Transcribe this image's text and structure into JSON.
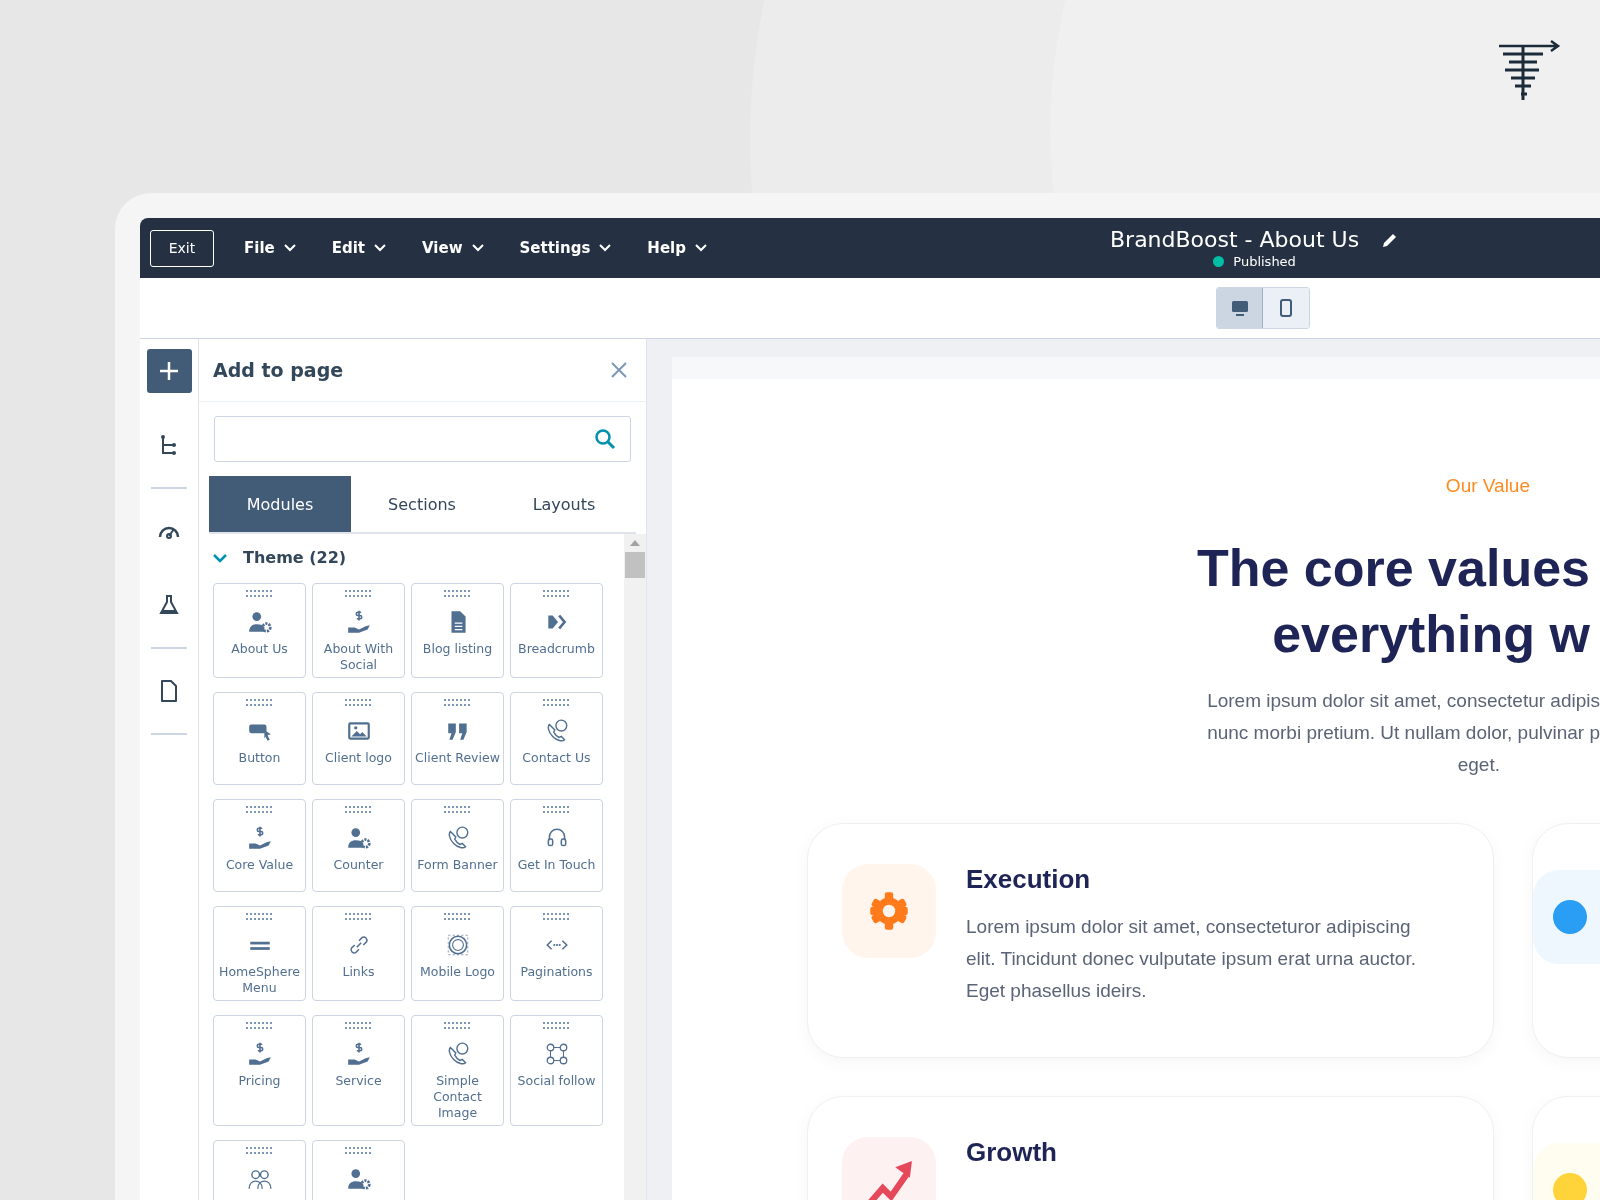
{
  "topbar": {
    "exit": "Exit",
    "menus": [
      {
        "label": "File"
      },
      {
        "label": "Edit"
      },
      {
        "label": "View"
      },
      {
        "label": "Settings"
      },
      {
        "label": "Help"
      }
    ],
    "title": "BrandBoost - About Us",
    "status": {
      "label": "Published",
      "color": "#00bda5"
    }
  },
  "device_toggle": [
    {
      "kind": "desktop",
      "selected": true
    },
    {
      "kind": "mobile",
      "selected": false
    }
  ],
  "rail": [
    {
      "kind": "add",
      "selected": true
    },
    {
      "kind": "tree",
      "selected": false
    },
    {
      "kind": "divider"
    },
    {
      "kind": "gauge",
      "selected": false
    },
    {
      "kind": "flask",
      "selected": false
    },
    {
      "kind": "divider"
    },
    {
      "kind": "page",
      "selected": false
    },
    {
      "kind": "divider"
    }
  ],
  "panel": {
    "title": "Add to page",
    "tabs": [
      {
        "label": "Modules",
        "selected": true
      },
      {
        "label": "Sections",
        "selected": false
      },
      {
        "label": "Layouts",
        "selected": false
      }
    ],
    "group": {
      "label": "Theme (22)",
      "expanded": true
    },
    "modules": [
      {
        "label": "About Us",
        "kind": "person"
      },
      {
        "label": "About With Social",
        "kind": "money"
      },
      {
        "label": "Blog listing",
        "kind": "document"
      },
      {
        "label": "Breadcrumb",
        "kind": "chevrons"
      },
      {
        "label": "Button",
        "kind": "button"
      },
      {
        "label": "Client logo",
        "kind": "image"
      },
      {
        "label": "Client Review",
        "kind": "quote"
      },
      {
        "label": "Contact Us",
        "kind": "phone"
      },
      {
        "label": "Core Value",
        "kind": "money"
      },
      {
        "label": "Counter",
        "kind": "person"
      },
      {
        "label": "Form Banner",
        "kind": "phone"
      },
      {
        "label": "Get In Touch",
        "kind": "headset"
      },
      {
        "label": "HomeSphere Menu",
        "kind": "menu"
      },
      {
        "label": "Links",
        "kind": "link"
      },
      {
        "label": "Mobile Logo",
        "kind": "logo"
      },
      {
        "label": "Paginations",
        "kind": "code"
      },
      {
        "label": "Pricing",
        "kind": "money"
      },
      {
        "label": "Service",
        "kind": "money"
      },
      {
        "label": "Simple Contact Image",
        "kind": "phone"
      },
      {
        "label": "Social follow",
        "kind": "social"
      },
      {
        "kind": "people"
      },
      {
        "kind": "person"
      }
    ]
  },
  "page": {
    "eyebrow": "Our Value",
    "heading": [
      "The core values",
      "everything w"
    ],
    "intro": [
      "Lorem ipsum dolor sit amet, consectetur adipis",
      "nunc morbi pretium. Ut nullam dolor, pulvinar p",
      "eget."
    ],
    "cards": [
      {
        "title": "Execution",
        "text": "Lorem ipsum dolor sit amet, consecteturor adipiscing elit. Tincidunt donec vulputate ipsum erat urna auctor. Eget phasellus ideirs.",
        "kind": "gear",
        "color": "#ff7a1a"
      },
      {
        "title": "Growth",
        "kind": "chart",
        "color": "#e5485b"
      }
    ],
    "side_cards": [
      {
        "kind": "circle",
        "color": "#2a9df4"
      },
      {
        "kind": "circle",
        "color": "#ffd43b"
      }
    ]
  }
}
